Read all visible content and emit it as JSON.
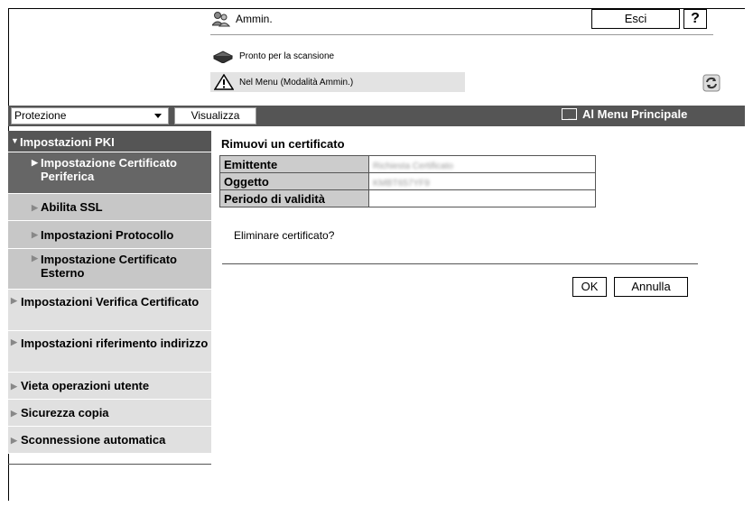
{
  "header": {
    "user": "Ammin.",
    "user_icon": "admin-users-icon",
    "logout_label": "Esci",
    "help_label": "?",
    "status_ready": "Pronto per la scansione",
    "status_mode": "Nel Menu (Modalità Ammin.)"
  },
  "toolbar": {
    "category_select": "Protezione",
    "view_button": "Visualizza",
    "main_menu": "Al Menu Principale"
  },
  "sidebar": {
    "items": [
      {
        "label": "Impostazioni PKI"
      },
      {
        "label": "Impostazione Certificato Periferica"
      },
      {
        "label": "Abilita SSL"
      },
      {
        "label": "Impostazioni Protocollo"
      },
      {
        "label": "Impostazione Certificato Esterno"
      },
      {
        "label": "Impostazioni Verifica Certificato"
      },
      {
        "label": "Impostazioni riferimento indirizzo"
      },
      {
        "label": "Vieta operazioni utente"
      },
      {
        "label": "Sicurezza copia"
      },
      {
        "label": "Sconnessione automatica"
      }
    ]
  },
  "content": {
    "title": "Rimuovi un certificato",
    "rows": [
      {
        "label": "Emittente",
        "value": "Richiesta Certificato"
      },
      {
        "label": "Oggetto",
        "value": "KMBT657YF9"
      },
      {
        "label": "Periodo di validità",
        "value": ""
      }
    ],
    "question": "Eliminare certificato?",
    "ok_label": "OK",
    "cancel_label": "Annulla"
  }
}
